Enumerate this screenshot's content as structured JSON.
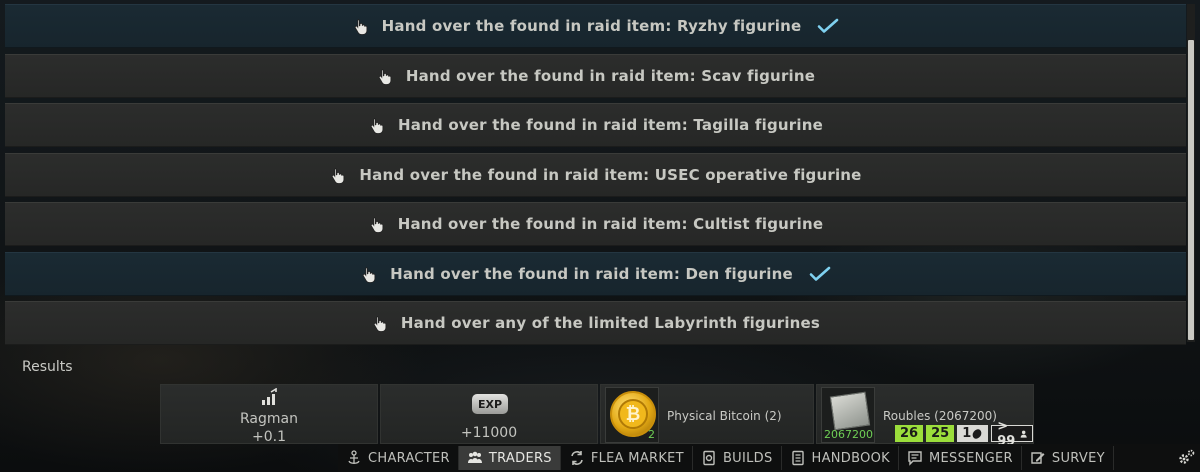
{
  "tasks": [
    {
      "label": "Hand over the found in raid item: Ryzhy figurine",
      "completed": true
    },
    {
      "label": "Hand over the found in raid item: Scav figurine",
      "completed": false
    },
    {
      "label": "Hand over the found in raid item: Tagilla figurine",
      "completed": false
    },
    {
      "label": "Hand over the found in raid item: USEC operative figurine",
      "completed": false
    },
    {
      "label": "Hand over the found in raid item: Cultist figurine",
      "completed": false
    },
    {
      "label": "Hand over the found in raid item: Den figurine",
      "completed": true
    },
    {
      "label": "Hand over any of the limited Labyrinth figurines",
      "completed": false
    }
  ],
  "results": {
    "label": "Results",
    "reputation": {
      "trader": "Ragman",
      "value": "+0.1"
    },
    "experience": {
      "badge": "EXP",
      "value": "+11000"
    },
    "bitcoin": {
      "name": "Physical Bitcoin (2)",
      "count": "2"
    },
    "roubles": {
      "name": "Roubles (2067200)",
      "count": "2067200",
      "badges": [
        "26",
        "25",
        "1",
        "> 99"
      ]
    }
  },
  "navbar": {
    "items": [
      {
        "label": "CHARACTER",
        "icon": "character-icon",
        "active": false
      },
      {
        "label": "TRADERS",
        "icon": "traders-icon",
        "active": true
      },
      {
        "label": "FLEA MARKET",
        "icon": "flea-market-icon",
        "active": false
      },
      {
        "label": "BUILDS",
        "icon": "builds-icon",
        "active": false
      },
      {
        "label": "HANDBOOK",
        "icon": "handbook-icon",
        "active": false
      },
      {
        "label": "MESSENGER",
        "icon": "messenger-icon",
        "active": false
      },
      {
        "label": "SURVEY",
        "icon": "survey-icon",
        "active": false
      }
    ],
    "settings_icon": "settings-gear-icon"
  },
  "colors": {
    "completed_row": "#17252d",
    "row": "#2a2b2a",
    "checkmark": "#7fd1f0",
    "stack_green": "#9bde3b"
  }
}
